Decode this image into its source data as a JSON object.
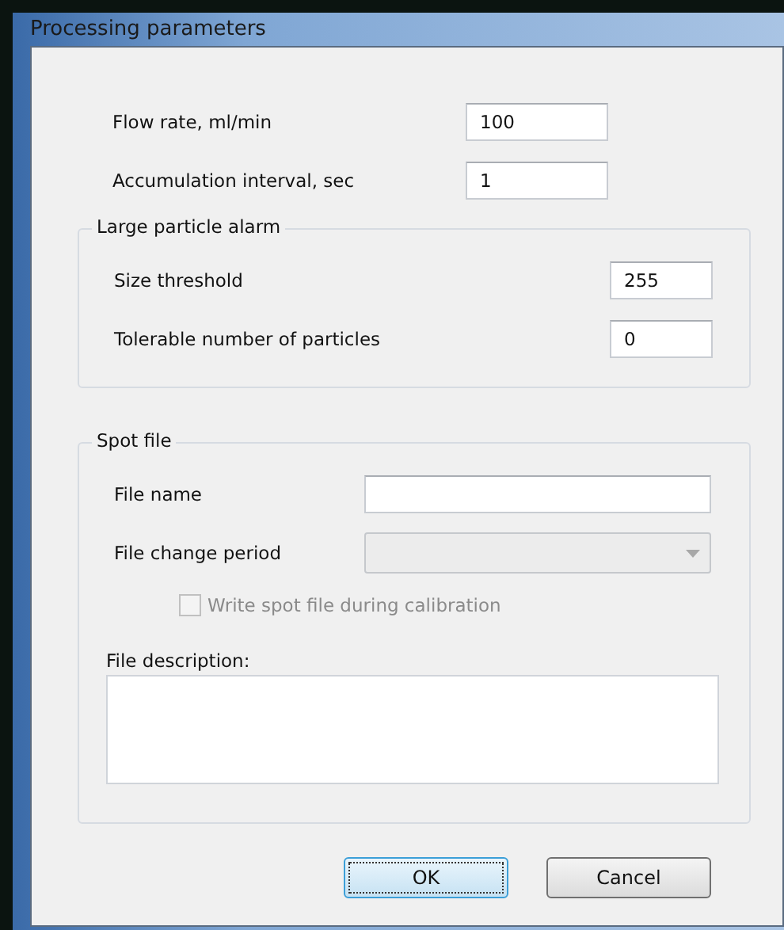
{
  "window": {
    "title": "Processing parameters"
  },
  "fields": [
    {
      "label": "Flow rate, ml/min",
      "value": "100"
    },
    {
      "label": "Accumulation interval, sec",
      "value": "1"
    }
  ],
  "large_particle_alarm": {
    "title": "Large particle alarm",
    "fields": [
      {
        "label": "Size threshold",
        "value": "255"
      },
      {
        "label": "Tolerable number of particles",
        "value": "0"
      }
    ]
  },
  "spot_file": {
    "title": "Spot file",
    "file_name": {
      "label": "File name"
    },
    "file_change_period": {
      "label": "File change period",
      "disabled": true
    },
    "write_during_calibration": {
      "label": "Write spot file during calibration",
      "checked": false,
      "disabled": true
    },
    "file_description": {
      "label": "File description:"
    }
  },
  "buttons": [
    {
      "label": "OK",
      "default": true
    },
    {
      "label": "Cancel",
      "default": false
    }
  ]
}
